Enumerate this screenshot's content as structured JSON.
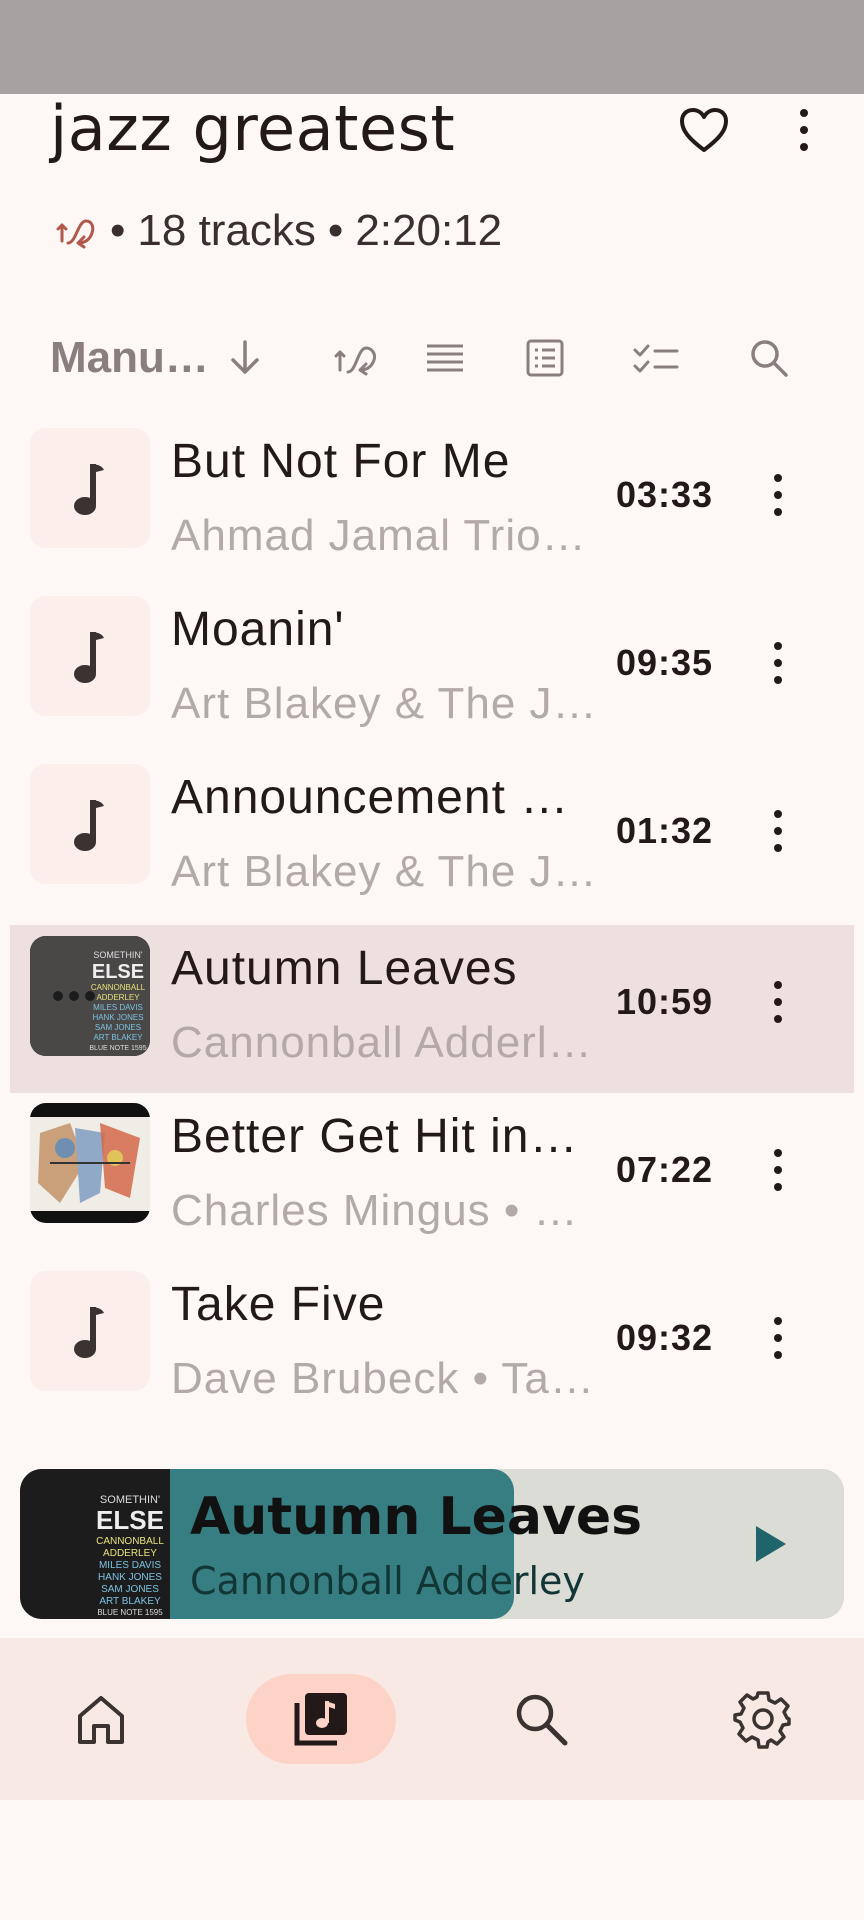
{
  "playlist": {
    "title": "jazz greatest",
    "track_count": "18 tracks",
    "duration": "2:20:12",
    "separator": "•"
  },
  "toolbar": {
    "sort_label": "Manu…",
    "icons": [
      "sort-direction-icon",
      "shuffle-icon",
      "list-view-icon",
      "detail-view-icon",
      "select-icon",
      "search-icon"
    ]
  },
  "tracks": [
    {
      "title": "But Not For Me",
      "subtitle": "Ahmad Jamal Trio…",
      "duration": "03:33",
      "has_art": false,
      "current": false
    },
    {
      "title": "Moanin'",
      "subtitle": "Art Blakey & The J…",
      "duration": "09:35",
      "has_art": false,
      "current": false
    },
    {
      "title": "Announcement …",
      "subtitle": "Art Blakey & The J…",
      "duration": "01:32",
      "has_art": false,
      "current": false
    },
    {
      "title": "Autumn Leaves",
      "subtitle": "Cannonball Adderl…",
      "duration": "10:59",
      "has_art": true,
      "current": true
    },
    {
      "title": "Better Get Hit in…",
      "subtitle": "Charles Mingus • …",
      "duration": "07:22",
      "has_art": true,
      "current": false
    },
    {
      "title": "Take Five",
      "subtitle": "Dave Brubeck • Ta…",
      "duration": "09:32",
      "has_art": false,
      "current": false
    }
  ],
  "album_art": {
    "lines": [
      "SOMETHIN'",
      "ELSE",
      "CANNONBALL",
      "ADDERLEY",
      "MILES DAVIS",
      "HANK JONES",
      "SAM JONES",
      "ART BLAKEY",
      "BLUE NOTE 1595"
    ]
  },
  "now_playing": {
    "title": "Autumn Leaves",
    "artist": "Cannonball Adderley",
    "progress": 0.6
  },
  "nav": {
    "items": [
      "home-icon",
      "library-icon",
      "search-icon",
      "settings-icon"
    ],
    "active": "library-icon"
  },
  "colors": {
    "accent": "#367e82",
    "current_row": "#ede0de",
    "nav_active": "#fdd3c7"
  }
}
